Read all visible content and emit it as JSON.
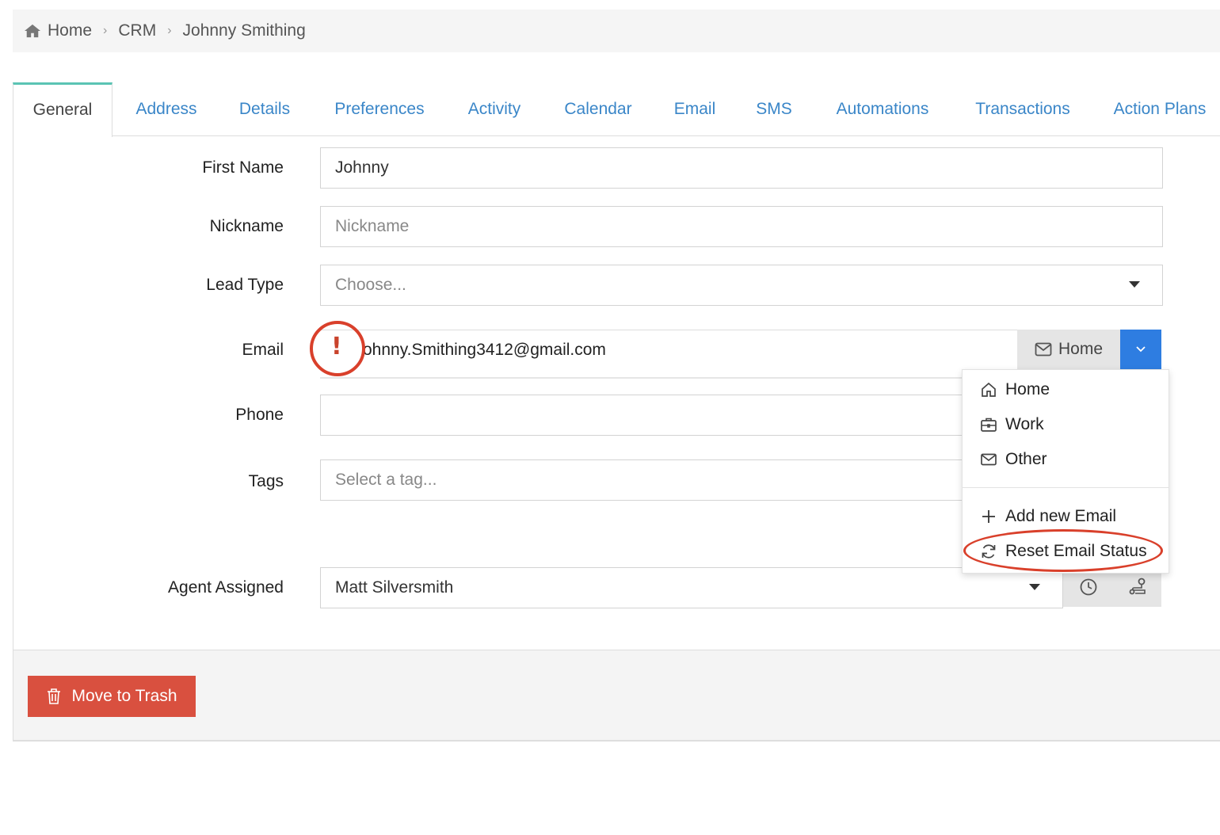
{
  "breadcrumb": {
    "items": [
      "Home",
      "CRM",
      "Johnny Smithing"
    ],
    "separator": "›"
  },
  "tabs": [
    {
      "label": "General",
      "active": true
    },
    {
      "label": "Address"
    },
    {
      "label": "Details"
    },
    {
      "label": "Preferences"
    },
    {
      "label": "Activity"
    },
    {
      "label": "Calendar"
    },
    {
      "label": "Email"
    },
    {
      "label": "SMS"
    },
    {
      "label": "Automations"
    },
    {
      "label": "Transactions"
    },
    {
      "label": "Action Plans"
    }
  ],
  "form": {
    "first_name": {
      "label": "First Name",
      "value": "Johnny"
    },
    "nickname": {
      "label": "Nickname",
      "placeholder": "Nickname"
    },
    "lead_type": {
      "label": "Lead Type",
      "placeholder": "Choose..."
    },
    "email": {
      "label": "Email",
      "value": "ohnny.Smithing3412@gmail.com",
      "type": "Home",
      "alert": "!"
    },
    "phone": {
      "label": "Phone",
      "value": ""
    },
    "tags": {
      "label": "Tags",
      "placeholder": "Select a tag..."
    },
    "agent": {
      "label": "Agent Assigned",
      "value": "Matt Silversmith"
    }
  },
  "email_menu": {
    "items": [
      {
        "label": "Home",
        "icon": "home-icon"
      },
      {
        "label": "Work",
        "icon": "briefcase-icon"
      },
      {
        "label": "Other",
        "icon": "envelope-icon"
      }
    ],
    "actions": [
      {
        "label": "Add new Email",
        "icon": "plus-icon"
      },
      {
        "label": "Reset Email Status",
        "icon": "refresh-icon"
      }
    ]
  },
  "footer": {
    "trash_label": "Move to Trash"
  },
  "colors": {
    "link": "#3a86c8",
    "accent_tab": "#5bc4b4",
    "primary": "#2e7de1",
    "danger": "#d9503f",
    "annotation": "#d9402b"
  }
}
